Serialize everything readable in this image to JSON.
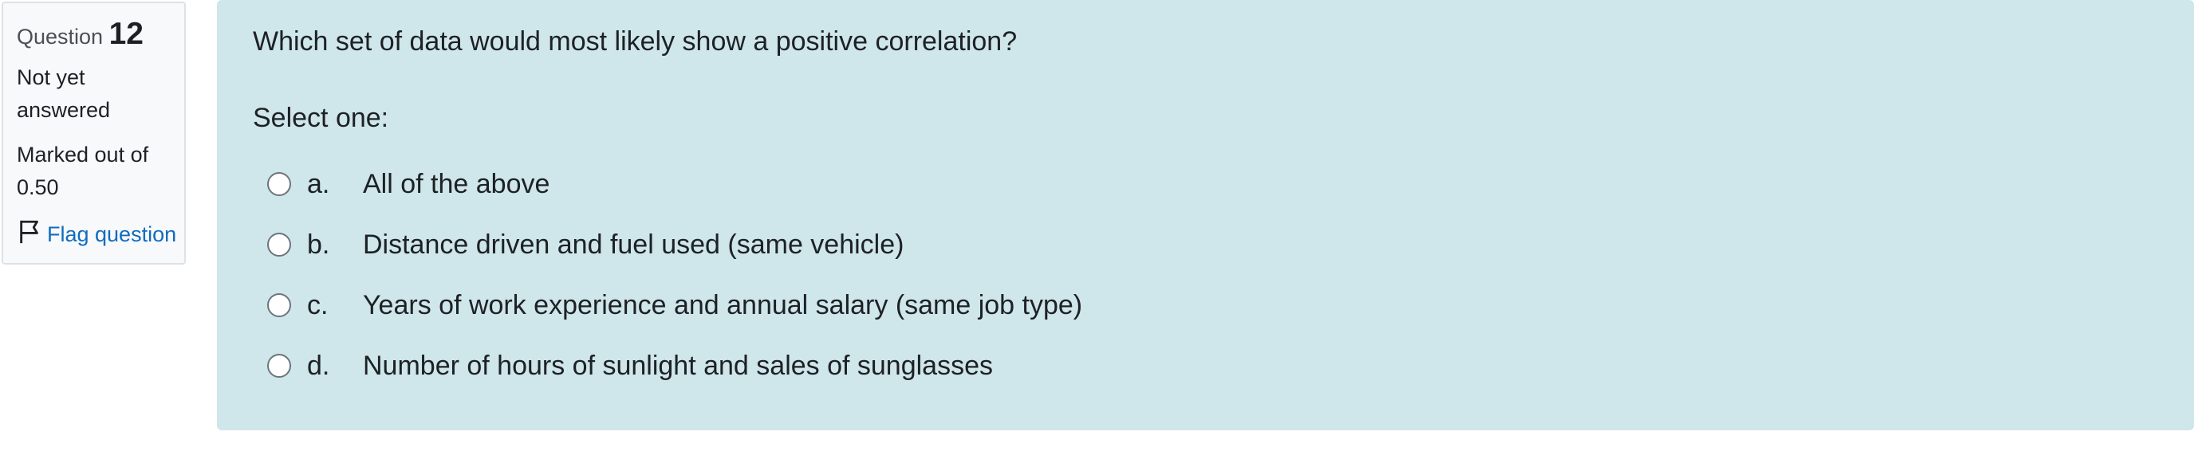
{
  "info": {
    "question_label": "Question",
    "question_number": "12",
    "state_line1": "Not yet",
    "state_line2": "answered",
    "grade_line1": "Marked out of",
    "grade_line2": "0.50",
    "flag_label": "Flag question",
    "flag_icon": "flag-outline-icon"
  },
  "question": {
    "text": "Which set of data would most likely show a positive correlation?",
    "prompt": "Select one:",
    "options": [
      {
        "letter": "a.",
        "text": "All of the above",
        "selected": false
      },
      {
        "letter": "b.",
        "text": "Distance driven and fuel used (same vehicle)",
        "selected": false
      },
      {
        "letter": "c.",
        "text": "Years of work experience and annual salary (same job type)",
        "selected": false
      },
      {
        "letter": "d.",
        "text": "Number of hours of sunlight and sales of sunglasses",
        "selected": false
      }
    ]
  },
  "colors": {
    "content_background": "#cfe6ea",
    "info_background": "#f8f9fa",
    "link": "#0f6cbf"
  }
}
